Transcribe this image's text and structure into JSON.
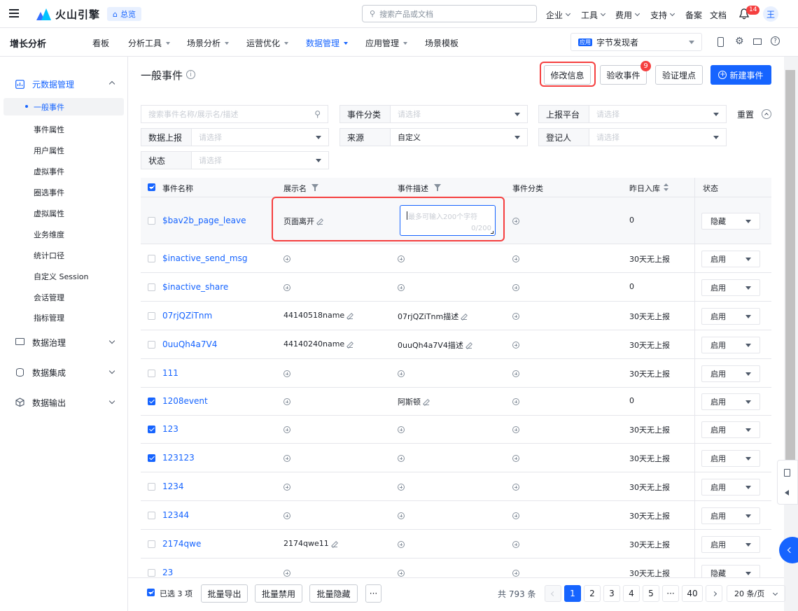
{
  "topbar": {
    "brand": "火山引擎",
    "overview": "总览",
    "search_placeholder": "搜索产品或文档",
    "links": [
      "企业",
      "工具",
      "费用",
      "支持",
      "备案",
      "文档"
    ],
    "notif_count": "14",
    "avatar": "王"
  },
  "nav": {
    "product": "增长分析",
    "items": [
      "看板",
      "分析工具",
      "场景分析",
      "运营优化",
      "数据管理",
      "应用管理",
      "场景模板"
    ],
    "active_index": 4,
    "app_badge": "应用",
    "app_name": "字节发现者"
  },
  "sidebar": {
    "group_meta": "元数据管理",
    "items": [
      "一般事件",
      "事件属性",
      "用户属性",
      "虚拟事件",
      "圈选事件",
      "虚拟属性",
      "业务维度",
      "统计口径",
      "自定义 Session",
      "会话管理",
      "指标管理"
    ],
    "active_index": 0,
    "groups": [
      "数据治理",
      "数据集成",
      "数据输出"
    ]
  },
  "header": {
    "title": "一般事件",
    "btn_edit": "修改信息",
    "btn_check": "验收事件",
    "check_badge": "9",
    "btn_verify": "验证埋点",
    "btn_new": "新建事件"
  },
  "filters": {
    "search_placeholder": "搜索事件名称/展示名/描述",
    "category_label": "事件分类",
    "category_placeholder": "请选择",
    "platform_label": "上报平台",
    "platform_placeholder": "请选择",
    "reset": "重置",
    "report_label": "数据上报",
    "report_placeholder": "请选择",
    "source_label": "来源",
    "source_value": "自定义",
    "registrar_label": "登记人",
    "registrar_placeholder": "请选择",
    "status_label": "状态",
    "status_placeholder": "请选择"
  },
  "table": {
    "headers": [
      "事件名称",
      "展示名",
      "事件描述",
      "事件分类",
      "昨日入库",
      "状态"
    ],
    "edit_placeholder": "最多可输入200个字符",
    "edit_counter": "0/200",
    "rows": [
      {
        "name": "$bav2b_page_leave",
        "display": "页面离开",
        "desc": "",
        "count": "0",
        "status": "隐藏",
        "checked": false
      },
      {
        "name": "$inactive_send_msg",
        "display": "",
        "desc": "",
        "count": "30天无上报",
        "status": "启用",
        "checked": false
      },
      {
        "name": "$inactive_share",
        "display": "",
        "desc": "",
        "count": "0",
        "status": "启用",
        "checked": false
      },
      {
        "name": "07rjQZiTnm",
        "display": "44140518name",
        "desc": "07rjQZiTnm描述",
        "count": "30天无上报",
        "status": "启用",
        "checked": false
      },
      {
        "name": "0uuQh4a7V4",
        "display": "44140240name",
        "desc": "0uuQh4a7V4描述",
        "count": "30天无上报",
        "status": "启用",
        "checked": false
      },
      {
        "name": "111",
        "display": "",
        "desc": "",
        "count": "30天无上报",
        "status": "启用",
        "checked": false
      },
      {
        "name": "1208event",
        "display": "",
        "desc": "阿斯顿",
        "count": "0",
        "status": "启用",
        "checked": true
      },
      {
        "name": "123",
        "display": "",
        "desc": "",
        "count": "30天无上报",
        "status": "启用",
        "checked": true
      },
      {
        "name": "123123",
        "display": "",
        "desc": "",
        "count": "30天无上报",
        "status": "启用",
        "checked": true
      },
      {
        "name": "1234",
        "display": "",
        "desc": "",
        "count": "30天无上报",
        "status": "启用",
        "checked": false
      },
      {
        "name": "12344",
        "display": "",
        "desc": "",
        "count": "30天无上报",
        "status": "启用",
        "checked": false
      },
      {
        "name": "2174qwe",
        "display": "2174qwe11",
        "desc": "",
        "count": "30天无上报",
        "status": "启用",
        "checked": false
      },
      {
        "name": "23",
        "display": "",
        "desc": "",
        "count": "30天无上报",
        "status": "隐藏",
        "checked": false
      }
    ]
  },
  "footer": {
    "selected": "已选 3 项",
    "btn_export": "批量导出",
    "btn_disable": "批量禁用",
    "btn_hide": "批量隐藏",
    "more": "···",
    "total": "共 793 条",
    "pages": [
      "1",
      "2",
      "3",
      "4",
      "5",
      "···",
      "40"
    ],
    "page_size": "20 条/页"
  },
  "colors": {
    "accent": "#1664ff",
    "highlight": "#f53f3f"
  }
}
